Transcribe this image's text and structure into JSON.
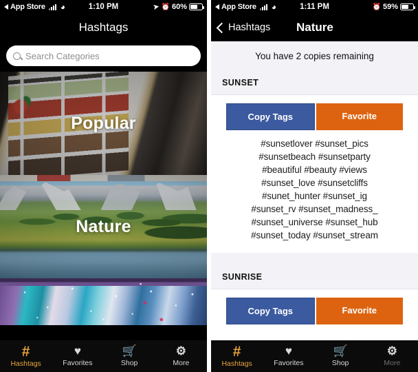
{
  "left": {
    "statusbar": {
      "back_label": "App Store",
      "signal_icon": "signal-bars-icon",
      "wifi_icon": "wifi-icon",
      "time": "1:10 PM",
      "location_icon": "location-arrow-icon",
      "alarm_icon": "alarm-clock-icon",
      "battery_percent": "60%",
      "battery_icon": "battery-icon"
    },
    "navbar": {
      "title": "Hashtags"
    },
    "search": {
      "icon": "search-icon",
      "placeholder": "Search Categories",
      "value": ""
    },
    "cards": [
      {
        "label": "Popular",
        "image": "instagram-grid-photo"
      },
      {
        "label": "Nature",
        "image": "alpine-mountain-lake-photo"
      },
      {
        "label": "",
        "image": "glitter-confetti-photo"
      }
    ],
    "tabbar": {
      "items": [
        {
          "icon": "hashtag-icon",
          "label": "Hashtags",
          "active": true
        },
        {
          "icon": "heart-icon",
          "label": "Favorites",
          "active": false
        },
        {
          "icon": "shopping-cart-icon",
          "label": "Shop",
          "active": false
        },
        {
          "icon": "gear-icon",
          "label": "More",
          "active": false
        }
      ]
    }
  },
  "right": {
    "statusbar": {
      "back_label": "App Store",
      "signal_icon": "signal-bars-icon",
      "wifi_icon": "wifi-icon",
      "time": "1:11 PM",
      "alarm_icon": "alarm-clock-icon",
      "battery_percent": "59%",
      "battery_icon": "battery-icon"
    },
    "navbar": {
      "back_icon": "chevron-left-icon",
      "back_label": "Hashtags",
      "title": "Nature"
    },
    "copies_notice": "You have 2 copies remaining",
    "sections": [
      {
        "title": "SUNSET",
        "copy_label": "Copy Tags",
        "favorite_label": "Favorite",
        "tag_lines": [
          "#sunsetlover #sunset_pics",
          "#sunsetbeach #sunsetparty",
          "#beautiful #beauty #views",
          "#sunset_love #sunsetcliffs",
          "#sunet_hunter #sunset_ig",
          "#sunset_rv #sunset_madness_",
          "#sunset_universe #sunset_hub",
          "#sunset_today #sunset_stream"
        ]
      },
      {
        "title": "SUNRISE",
        "copy_label": "Copy Tags",
        "favorite_label": "Favorite",
        "tag_lines": []
      }
    ],
    "tabbar": {
      "items": [
        {
          "icon": "hashtag-icon",
          "label": "Hashtags",
          "active": true
        },
        {
          "icon": "heart-icon",
          "label": "Favorites",
          "active": false
        },
        {
          "icon": "shopping-cart-icon",
          "label": "Shop",
          "active": false
        },
        {
          "icon": "gear-icon",
          "label": "More",
          "active": false
        }
      ]
    }
  },
  "colors": {
    "accent_orange": "#e8a33d",
    "button_blue": "#3b5aa0",
    "button_orange": "#dd6310",
    "section_bg": "#f2f2f7",
    "bar_black": "#000000"
  }
}
